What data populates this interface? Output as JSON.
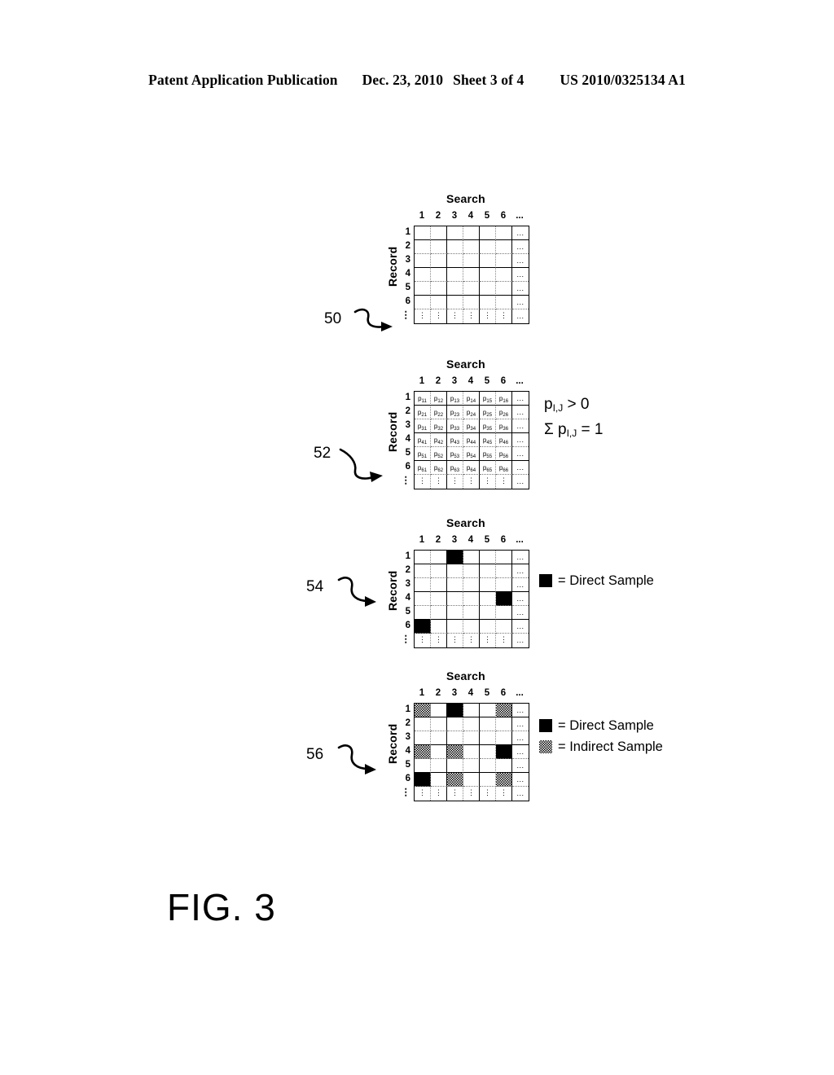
{
  "header": {
    "publication": "Patent Application Publication",
    "date": "Dec. 23, 2010",
    "sheet": "Sheet 3 of 4",
    "number": "US 2010/0325134 A1"
  },
  "figure": {
    "label": "FIG. 3",
    "axis_labels": {
      "columns": "Search",
      "rows": "Record"
    },
    "col_headers": [
      "1",
      "2",
      "3",
      "4",
      "5",
      "6",
      "..."
    ],
    "row_headers": [
      "1",
      "2",
      "3",
      "4",
      "5",
      "6",
      "⋮"
    ],
    "cell_ellipsis_h": "...",
    "cell_ellipsis_v": "⋮",
    "matrices": [
      {
        "ref": "50",
        "caption_columns": "Search",
        "caption_rows": "Record",
        "kind": "empty",
        "cells": []
      },
      {
        "ref": "52",
        "caption_columns": "Search",
        "caption_rows": "Record",
        "kind": "probabilities",
        "cell_symbol": "p",
        "cell_values": [
          [
            "p11",
            "p12",
            "p13",
            "p14",
            "p15",
            "p16"
          ],
          [
            "p21",
            "p22",
            "p23",
            "p24",
            "p25",
            "p26"
          ],
          [
            "p31",
            "p32",
            "p33",
            "p34",
            "p35",
            "p36"
          ],
          [
            "p41",
            "p42",
            "p43",
            "p44",
            "p45",
            "p46"
          ],
          [
            "p51",
            "p52",
            "p53",
            "p54",
            "p55",
            "p56"
          ],
          [
            "p61",
            "p62",
            "p63",
            "p64",
            "p65",
            "p66"
          ]
        ]
      },
      {
        "ref": "54",
        "caption_columns": "Search",
        "caption_rows": "Record",
        "kind": "direct-samples",
        "direct": [
          [
            1,
            3
          ],
          [
            4,
            6
          ],
          [
            6,
            1
          ]
        ],
        "indirect": []
      },
      {
        "ref": "56",
        "caption_columns": "Search",
        "caption_rows": "Record",
        "kind": "direct-and-indirect-samples",
        "direct": [
          [
            1,
            3
          ],
          [
            4,
            6
          ],
          [
            6,
            1
          ]
        ],
        "indirect": [
          [
            1,
            1
          ],
          [
            1,
            6
          ],
          [
            4,
            1
          ],
          [
            4,
            3
          ],
          [
            6,
            3
          ],
          [
            6,
            6
          ]
        ]
      }
    ],
    "equations": {
      "inequality": "p",
      "inequality_sub": "I,J",
      "inequality_rest": ">  0",
      "sum_prefix": "Σ p",
      "sum_sub": "I,J",
      "sum_rest": "= 1"
    },
    "legends": [
      {
        "for_ref": "54",
        "entries": [
          {
            "swatch": "direct",
            "label": "= Direct Sample"
          }
        ]
      },
      {
        "for_ref": "56",
        "entries": [
          {
            "swatch": "direct",
            "label": "= Direct Sample"
          },
          {
            "swatch": "indirect",
            "label": "= Indirect Sample"
          }
        ]
      }
    ]
  },
  "colors": {
    "ink": "#000000",
    "paper": "#ffffff",
    "grid_light": "#888888"
  }
}
